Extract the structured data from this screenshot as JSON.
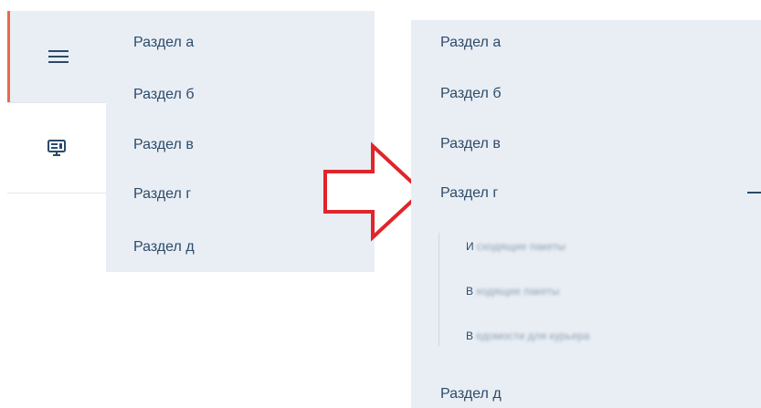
{
  "left_panel": {
    "rail": {
      "menu_icon": "hamburger-icon",
      "monitor_icon": "monitor-icon"
    },
    "items": [
      {
        "label": "Раздел а"
      },
      {
        "label": "Раздел б"
      },
      {
        "label": "Раздел в"
      },
      {
        "label": "Раздел г"
      },
      {
        "label": "Раздел д"
      }
    ],
    "expand_icon": "plus-icon"
  },
  "transition_arrow": {
    "icon": "right-arrow-icon",
    "color": "#e0252b"
  },
  "right_panel": {
    "items_before": [
      {
        "label": "Раздел а"
      },
      {
        "label": "Раздел б"
      },
      {
        "label": "Раздел в"
      },
      {
        "label": "Раздел г"
      }
    ],
    "collapse_icon": "minus-icon",
    "subitems": [
      {
        "first_letter": "И",
        "rest": "сходящие пакеты"
      },
      {
        "first_letter": "В",
        "rest": "ходящие пакеты"
      },
      {
        "first_letter": "В",
        "rest": "едомости для курьера"
      }
    ],
    "item_after": {
      "label": "Раздел д"
    }
  },
  "colors": {
    "panel_bg": "#e9eef4",
    "text": "#2c4b6a",
    "accent_border": "#e86a4a"
  }
}
